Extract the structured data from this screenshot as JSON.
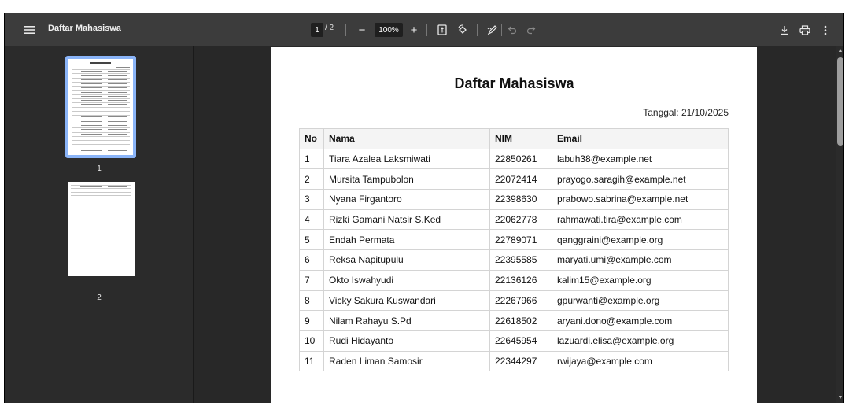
{
  "toolbar": {
    "title": "Daftar Mahasiswa",
    "current_page": "1",
    "total_pages": "/ 2",
    "zoom": "100%",
    "zoom_out_label": "−",
    "zoom_in_label": "+"
  },
  "sidebar": {
    "thumbnails": [
      {
        "label": "1",
        "selected": true
      },
      {
        "label": "2",
        "selected": false
      }
    ]
  },
  "document": {
    "title": "Daftar Mahasiswa",
    "date": "Tanggal: 21/10/2025",
    "columns": [
      "No",
      "Nama",
      "NIM",
      "Email"
    ],
    "rows": [
      [
        "1",
        "Tiara Azalea Laksmiwati",
        "22850261",
        "labuh38@example.net"
      ],
      [
        "2",
        "Mursita Tampubolon",
        "22072414",
        "prayogo.saragih@example.net"
      ],
      [
        "3",
        "Nyana Firgantoro",
        "22398630",
        "prabowo.sabrina@example.net"
      ],
      [
        "4",
        "Rizki Gamani Natsir S.Ked",
        "22062778",
        "rahmawati.tira@example.com"
      ],
      [
        "5",
        "Endah Permata",
        "22789071",
        "qanggraini@example.org"
      ],
      [
        "6",
        "Reksa Napitupulu",
        "22395585",
        "maryati.umi@example.com"
      ],
      [
        "7",
        "Okto Iswahyudi",
        "22136126",
        "kalim15@example.org"
      ],
      [
        "8",
        "Vicky Sakura Kuswandari",
        "22267966",
        "gpurwanti@example.org"
      ],
      [
        "9",
        "Nilam Rahayu S.Pd",
        "22618502",
        "aryani.dono@example.com"
      ],
      [
        "10",
        "Rudi Hidayanto",
        "22645954",
        "lazuardi.elisa@example.org"
      ],
      [
        "11",
        "Raden Liman Samosir",
        "22344297",
        "rwijaya@example.com"
      ]
    ]
  },
  "colors": {
    "toolbar_bg": "#3c3c3c",
    "viewer_bg": "#282828",
    "thumbnail_selected": "#8ab4f8"
  },
  "icons": [
    "menu-icon",
    "fit-page-icon",
    "rotate-icon",
    "annotate-icon",
    "undo-icon",
    "redo-icon",
    "download-icon",
    "print-icon",
    "more-options-icon"
  ]
}
